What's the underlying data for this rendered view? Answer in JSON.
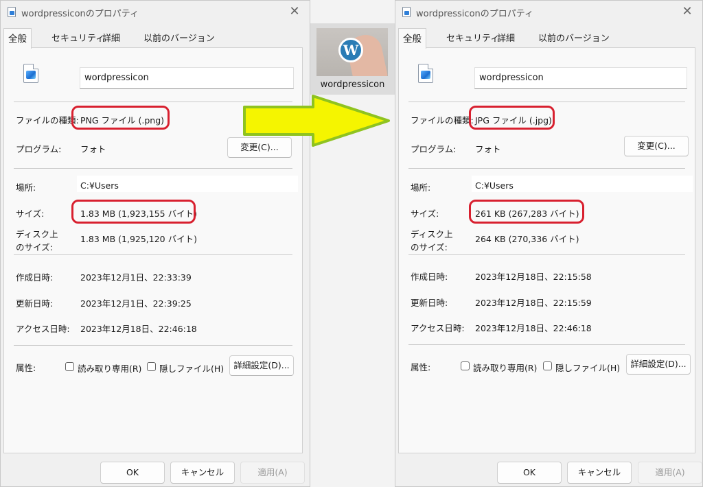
{
  "left": {
    "title": "wordpressiconのプロパティ",
    "tabs": [
      "全般",
      "セキュリティ",
      "詳細",
      "以前のバージョン"
    ],
    "filename": "wordpressicon",
    "rows": {
      "type_label": "ファイルの種類:",
      "type_value": "PNG ファイル (.png)",
      "program_label": "プログラム:",
      "program_value": "フォト",
      "change_button": "変更(C)...",
      "location_label": "場所:",
      "location_value": "C:¥Users",
      "size_label": "サイズ:",
      "size_value": "1.83 MB (1,923,155 バイト)",
      "disk_label_1": "ディスク上",
      "disk_label_2": "のサイズ:",
      "disk_value": "1.83 MB (1,925,120 バイト)",
      "created_label": "作成日時:",
      "created_value": "2023年12月1日、22:33:39",
      "modified_label": "更新日時:",
      "modified_value": "2023年12月1日、22:39:25",
      "accessed_label": "アクセス日時:",
      "accessed_value": "2023年12月18日、22:46:18",
      "attr_label": "属性:",
      "readonly_label": "読み取り専用(R)",
      "hidden_label": "隠しファイル(H)",
      "advanced_button": "詳細設定(D)..."
    },
    "footer": {
      "ok": "OK",
      "cancel": "キャンセル",
      "apply": "適用(A)"
    }
  },
  "middle": {
    "thumbnail_label": "wordpressicon",
    "logo_glyph": "W"
  },
  "right": {
    "title": "wordpressiconのプロパティ",
    "tabs": [
      "全般",
      "セキュリティ",
      "詳細",
      "以前のバージョン"
    ],
    "filename": "wordpressicon",
    "rows": {
      "type_label": "ファイルの種類:",
      "type_value": "JPG ファイル (.jpg)",
      "program_label": "プログラム:",
      "program_value": "フォト",
      "change_button": "変更(C)...",
      "location_label": "場所:",
      "location_value": "C:¥Users",
      "size_label": "サイズ:",
      "size_value": "261 KB (267,283 バイト)",
      "disk_label_1": "ディスク上",
      "disk_label_2": "のサイズ:",
      "disk_value": "264 KB (270,336 バイト)",
      "created_label": "作成日時:",
      "created_value": "2023年12月18日、22:15:58",
      "modified_label": "更新日時:",
      "modified_value": "2023年12月18日、22:15:59",
      "accessed_label": "アクセス日時:",
      "accessed_value": "2023年12月18日、22:46:18",
      "attr_label": "属性:",
      "readonly_label": "読み取り専用(R)",
      "hidden_label": "隠しファイル(H)",
      "advanced_button": "詳細設定(D)..."
    },
    "footer": {
      "ok": "OK",
      "cancel": "キャンセル",
      "apply": "適用(A)"
    }
  },
  "colors": {
    "highlight": "#d8202f",
    "arrow_fill": "#f5f500",
    "arrow_stroke": "#8fc31f"
  }
}
